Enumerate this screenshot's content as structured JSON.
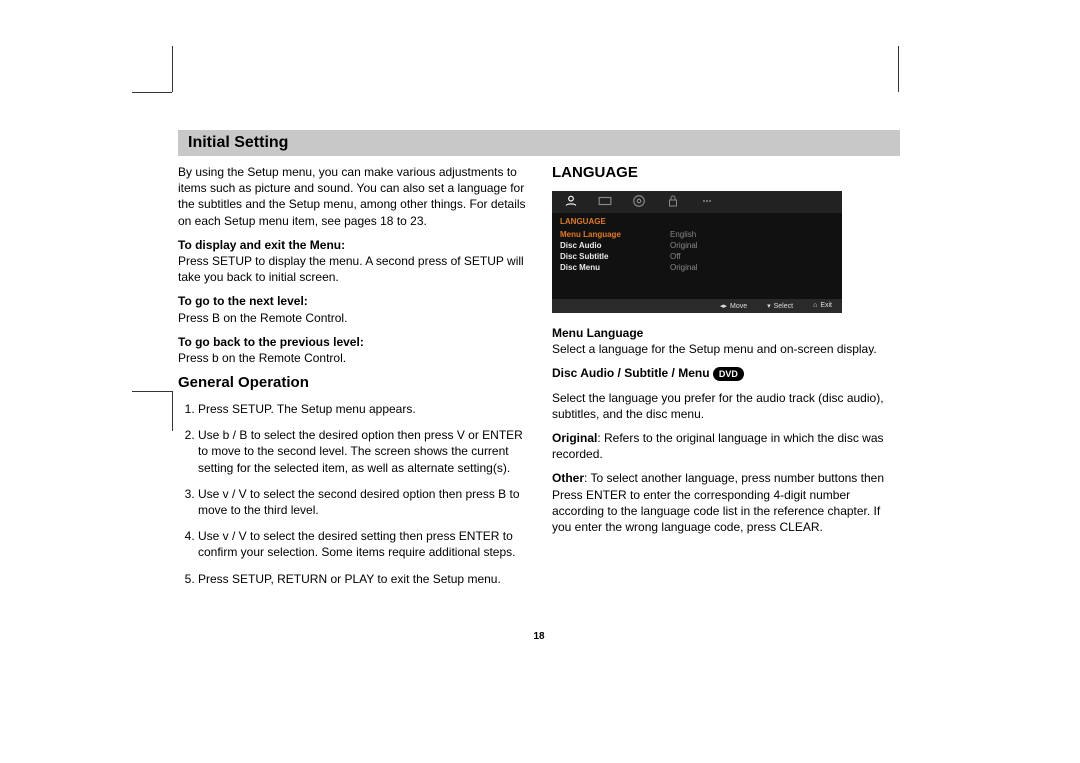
{
  "section_title": "Initial Setting",
  "page_number": "18",
  "left": {
    "intro": "By using the Setup menu, you can make various adjustments to items such as picture and sound. You can also set a language for the subtitles and the Setup menu, among other things. For details on each Setup menu item, see pages 18 to 23.",
    "h_display_exit": "To display and exit the Menu:",
    "display_exit_body": "Press SETUP to display the menu. A second press of SETUP will take you back to initial screen.",
    "h_next": "To go to the next level:",
    "next_body": "Press B on the Remote Control.",
    "h_prev": "To go back to the previous level:",
    "prev_body": "Press b on the Remote Control.",
    "general_op_heading": "General Operation",
    "steps": [
      "Press SETUP. The Setup menu appears.",
      "Use b / B to select the desired option then press V or ENTER to move to the second level. The screen shows the current setting for the selected item, as well as alternate setting(s).",
      "Use v / V to select the second desired option then press B to move to the third level.",
      "Use v / V to select the desired setting then press ENTER to confirm your selection. Some items require additional steps.",
      "Press SETUP, RETURN or PLAY to exit the Setup menu."
    ]
  },
  "right": {
    "heading": "LANGUAGE",
    "osd": {
      "title": "LANGUAGE",
      "rows": [
        {
          "k": "Menu Language",
          "v": "English"
        },
        {
          "k": "Disc Audio",
          "v": "Original"
        },
        {
          "k": "Disc Subtitle",
          "v": "Off"
        },
        {
          "k": "Disc Menu",
          "v": "Original"
        }
      ],
      "foot_move": "Move",
      "foot_select": "Select",
      "foot_exit": "Exit"
    },
    "menu_lang_h": "Menu Language",
    "menu_lang_body": "Select a language for the Setup menu and on-screen display.",
    "disc_lang_h": "Disc Audio / Subtitle / Menu",
    "dvd_label": "DVD",
    "disc_lang_body": "Select the language you prefer for the audio track (disc audio), subtitles, and the disc menu.",
    "original_label": "Original",
    "original_body": ": Refers to the original language in which the disc was recorded.",
    "other_label": "Other",
    "other_body": ": To select another language, press number buttons then Press ENTER to enter the corresponding 4-digit number according to the language code list in the reference chapter. If you enter the wrong language code, press CLEAR."
  }
}
